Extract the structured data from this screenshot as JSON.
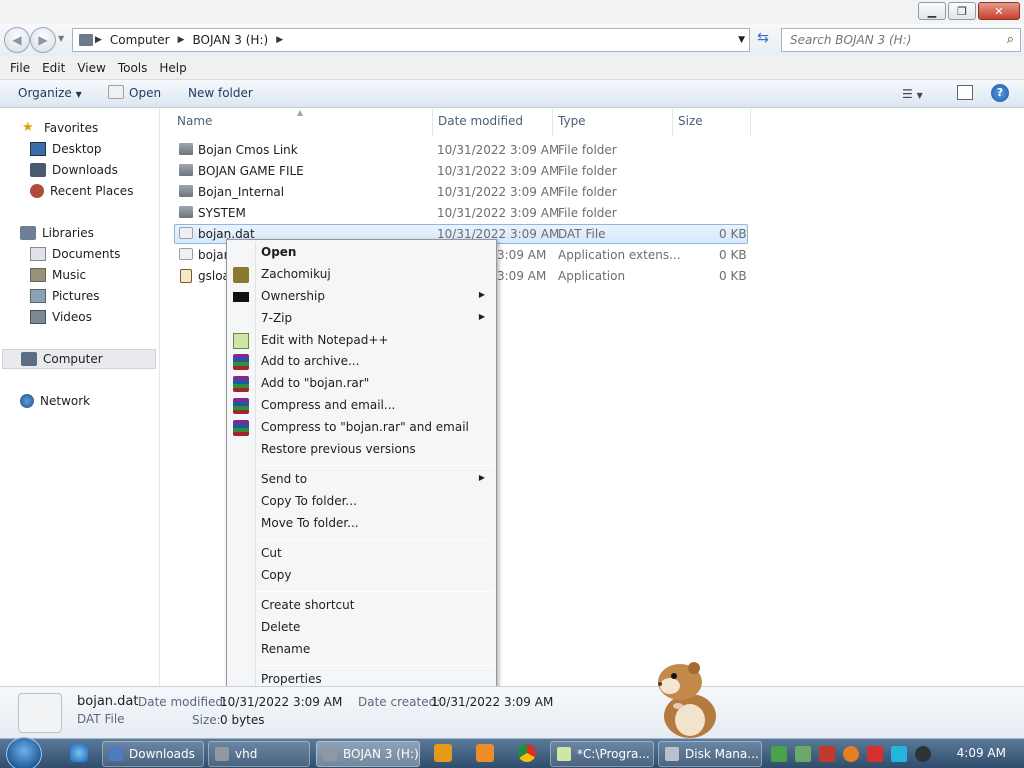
{
  "window": {
    "minimize": "▁",
    "maximize": "❐",
    "close": "✕"
  },
  "breadcrumb": [
    "Computer",
    "BOJAN 3 (H:)"
  ],
  "search": {
    "placeholder": "Search BOJAN 3 (H:)"
  },
  "menu": [
    "File",
    "Edit",
    "View",
    "Tools",
    "Help"
  ],
  "toolbar": {
    "organize": "Organize",
    "open": "Open",
    "new_folder": "New folder"
  },
  "sidebar": {
    "favorites": "Favorites",
    "favorites_items": [
      "Desktop",
      "Downloads",
      "Recent Places"
    ],
    "libraries": "Libraries",
    "libraries_items": [
      "Documents",
      "Music",
      "Pictures",
      "Videos"
    ],
    "computer": "Computer",
    "network": "Network"
  },
  "columns": {
    "name": "Name",
    "date": "Date modified",
    "type": "Type",
    "size": "Size"
  },
  "files": [
    {
      "name": "Bojan Cmos Link",
      "date": "10/31/2022 3:09 AM",
      "type": "File folder",
      "size": ""
    },
    {
      "name": "BOJAN GAME FILE",
      "date": "10/31/2022 3:09 AM",
      "type": "File folder",
      "size": ""
    },
    {
      "name": "Bojan_Internal",
      "date": "10/31/2022 3:09 AM",
      "type": "File folder",
      "size": ""
    },
    {
      "name": "SYSTEM",
      "date": "10/31/2022 3:09 AM",
      "type": "File folder",
      "size": ""
    },
    {
      "name": "bojan.dat",
      "date": "10/31/2022 3:09 AM",
      "type": "DAT File",
      "size": "0 KB"
    },
    {
      "name": "bojan",
      "date": "3:09 AM",
      "type": "Application extens...",
      "size": "0 KB"
    },
    {
      "name": "gsloa",
      "date": "3:09 AM",
      "type": "Application",
      "size": "0 KB"
    }
  ],
  "context_menu": {
    "open": "Open",
    "zachomikuj": "Zachomikuj",
    "ownership": "Ownership",
    "zip": "7-Zip",
    "notepad": "Edit with Notepad++",
    "add_archive": "Add to archive...",
    "add_rar": "Add to \"bojan.rar\"",
    "compress_email": "Compress and email...",
    "compress_rar_email": "Compress to \"bojan.rar\" and email",
    "restore": "Restore previous versions",
    "send_to": "Send to",
    "copy_to": "Copy To folder...",
    "move_to": "Move To folder...",
    "cut": "Cut",
    "copy": "Copy",
    "shortcut": "Create shortcut",
    "delete": "Delete",
    "rename": "Rename",
    "properties": "Properties"
  },
  "details": {
    "name": "bojan.dat",
    "type": "DAT File",
    "modified_label": "Date modified:",
    "modified": "10/31/2022 3:09 AM",
    "created_label": "Date created:",
    "created": "10/31/2022 3:09 AM",
    "size_label": "Size:",
    "size": "0 bytes"
  },
  "taskbar": {
    "downloads": "Downloads",
    "vhd": "vhd",
    "bojan": "BOJAN 3 (H:)",
    "program": "*C:\\Progra...",
    "disk": "Disk Mana...",
    "clock": "4:09 AM"
  }
}
